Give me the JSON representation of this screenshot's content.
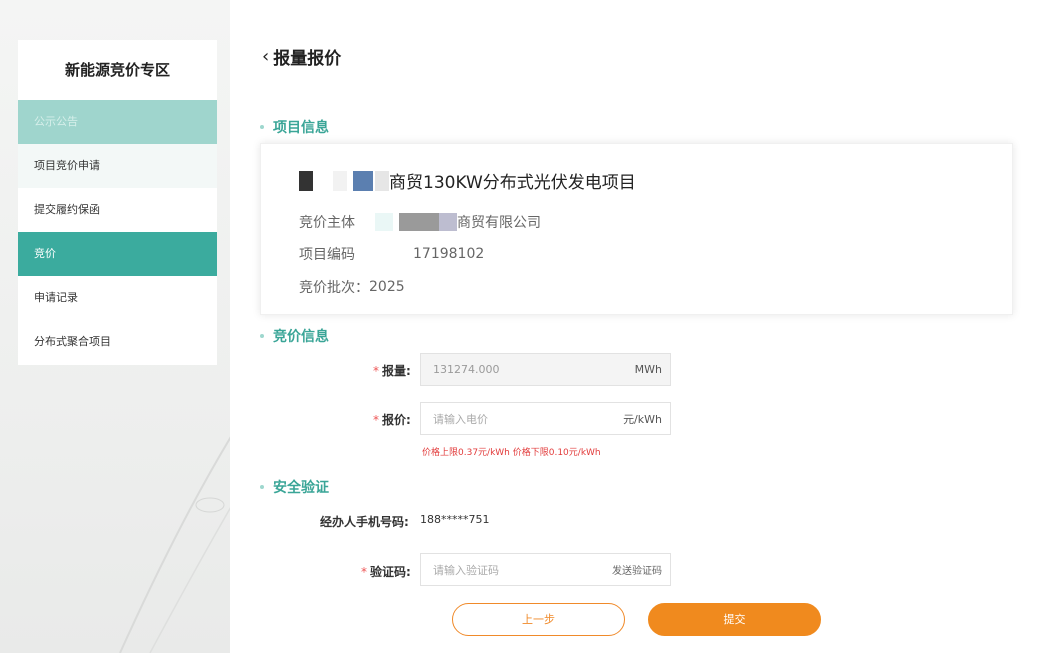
{
  "sidebar": {
    "title": "新能源竞价专区",
    "items": [
      {
        "label": "公示公告"
      },
      {
        "label": "项目竞价申请"
      },
      {
        "label": "提交履约保函"
      },
      {
        "label": "竞价"
      },
      {
        "label": "申请记录"
      },
      {
        "label": "分布式聚合项目"
      }
    ]
  },
  "header": {
    "back_icon": "chevron-left-icon",
    "title": "报量报价"
  },
  "project_section": {
    "title": "项目信息",
    "project_name": "商贸130KW分布式光伏发电项目",
    "subject_label": "竞价主体",
    "subject_value": "商贸有限公司",
    "code_label": "项目编码",
    "code_value": "17198102",
    "batch_label": "竞价批次：",
    "batch_value": "2025"
  },
  "bid_section": {
    "title": "竞价信息",
    "quantity_label": "报量:",
    "quantity_value": "131274.000",
    "quantity_unit": "MWh",
    "price_label": "报价:",
    "price_placeholder": "请输入电价",
    "price_unit": "元/kWh",
    "price_hint": "价格上限0.37元/kWh 价格下限0.10元/kWh"
  },
  "security_section": {
    "title": "安全验证",
    "phone_label": "经办人手机号码:",
    "phone_value": "188*****751",
    "code_label": "验证码:",
    "code_placeholder": "请输入验证码",
    "send_code": "发送验证码"
  },
  "actions": {
    "prev": "上一步",
    "submit": "提交"
  },
  "colors": {
    "accent": "#3bab9e",
    "accent_light": "#9fd5cd",
    "orange": "#f08a1e",
    "error": "#e23b3b"
  }
}
